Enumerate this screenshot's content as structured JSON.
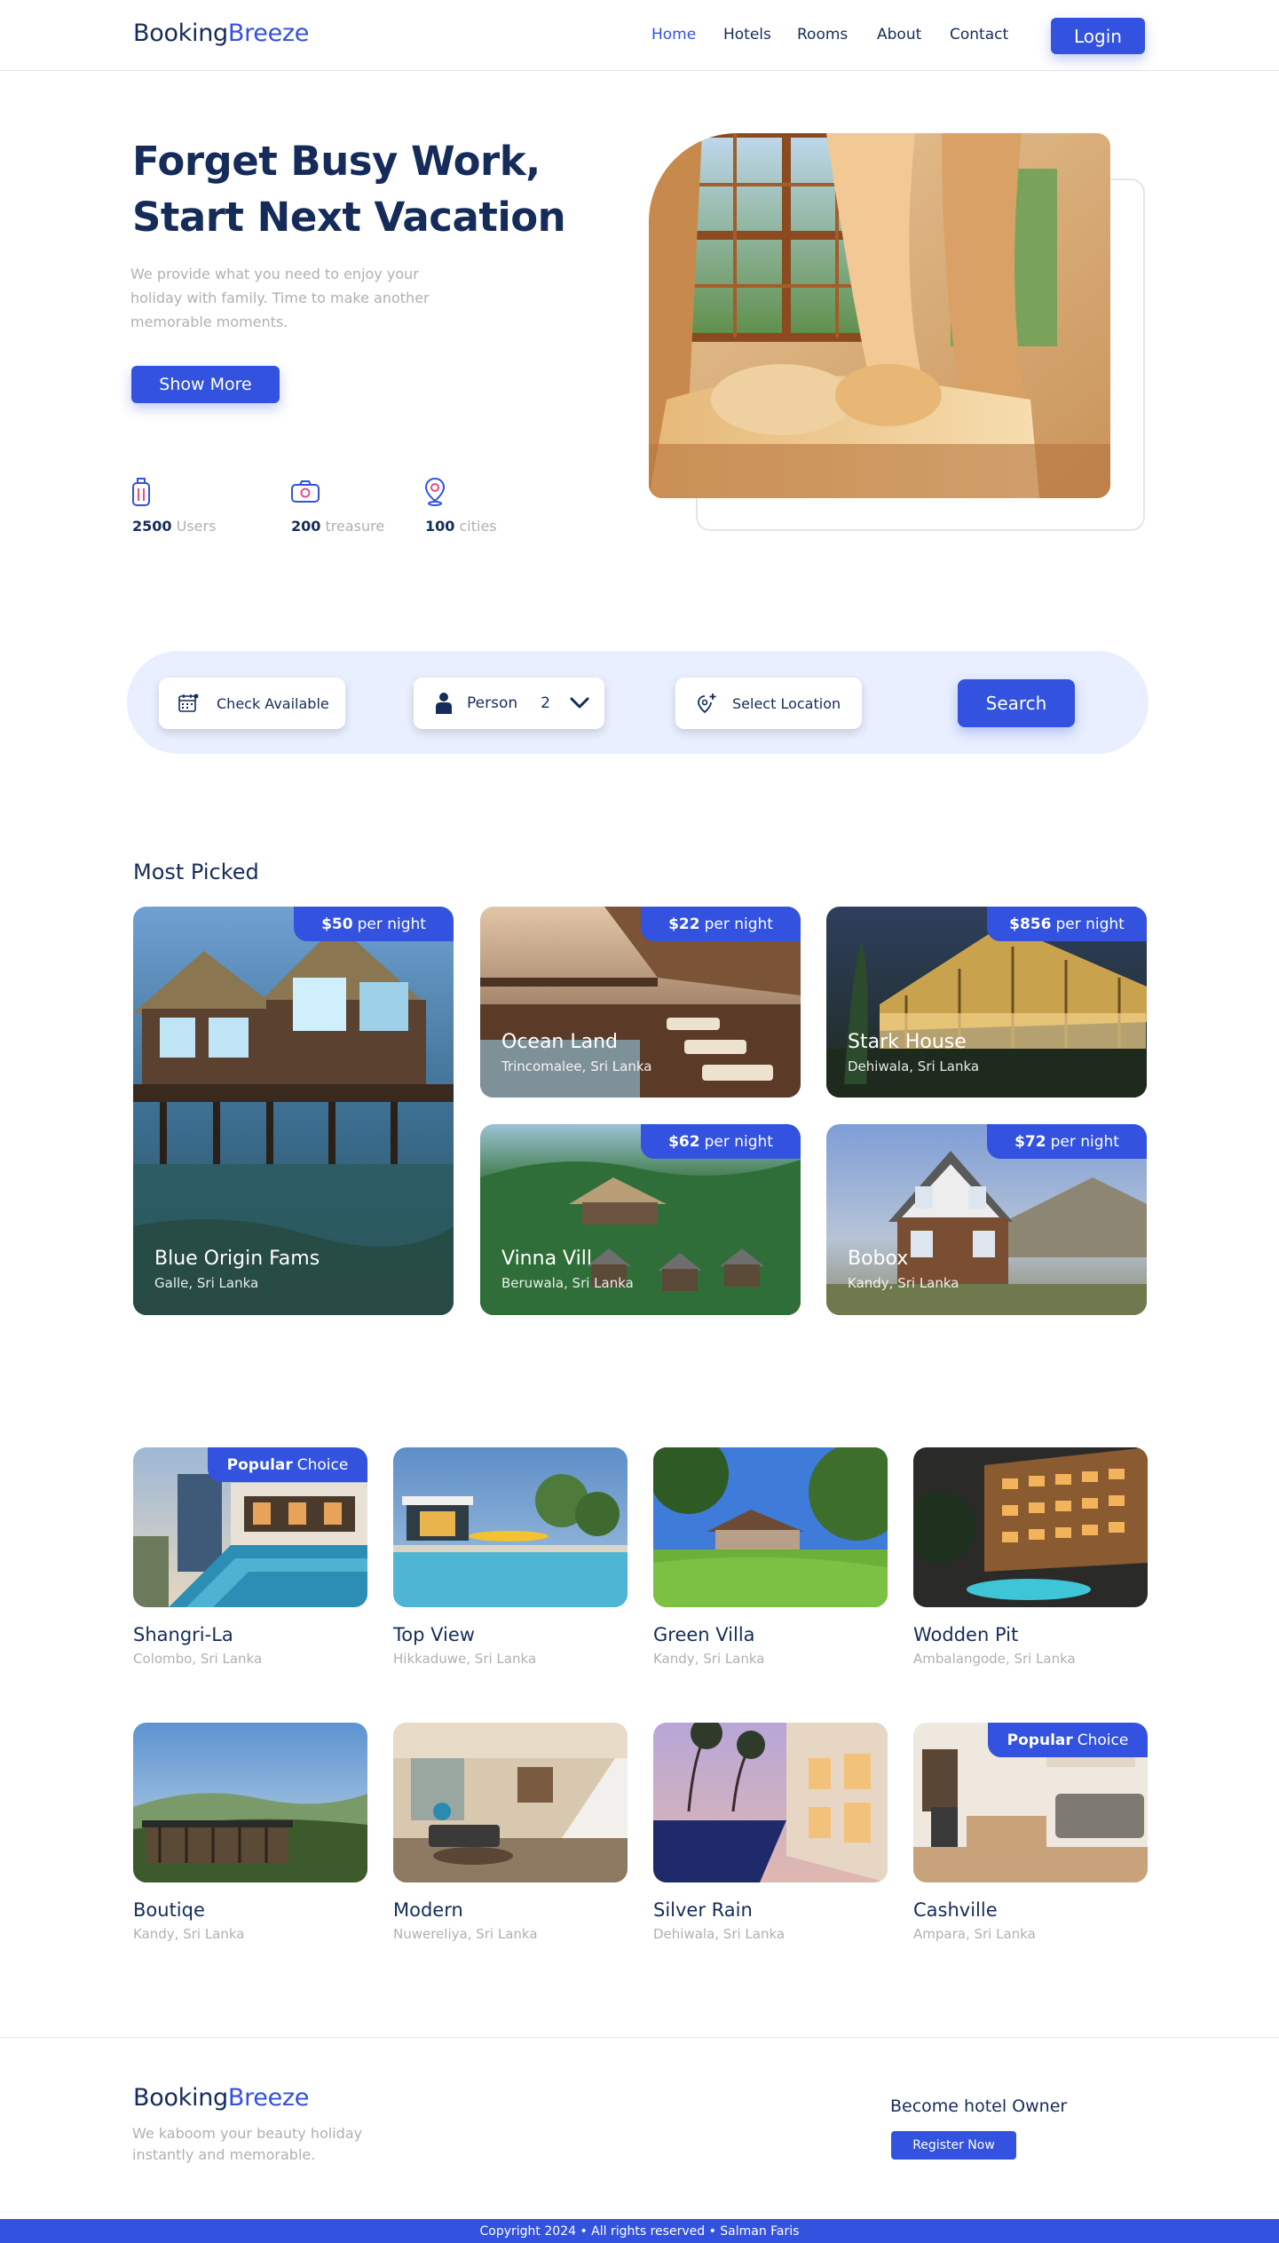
{
  "brand": {
    "part1": "Booking",
    "part2": "Breeze"
  },
  "nav": {
    "home": "Home",
    "hotels": "Hotels",
    "rooms": "Rooms",
    "about": "About",
    "contact": "Contact",
    "login": "Login"
  },
  "hero": {
    "title_line1": "Forget Busy Work,",
    "title_line2": "Start Next Vacation",
    "description": "We provide what you need to enjoy your holiday with family. Time to make another memorable moments.",
    "cta": "Show More",
    "stats": [
      {
        "value": "2500",
        "label": "Users",
        "icon": "suitcase-icon"
      },
      {
        "value": "200",
        "label": "treasure",
        "icon": "camera-icon"
      },
      {
        "value": "100",
        "label": "cities",
        "icon": "map-pin-icon"
      }
    ]
  },
  "search": {
    "check_label": "Check Available",
    "person_label": "Person",
    "person_count": "2",
    "location_label": "Select Location",
    "search_button": "Search"
  },
  "most_picked": {
    "title": "Most Picked",
    "per_night": "per night",
    "items": [
      {
        "price": "$50",
        "name": "Blue Origin Fams",
        "location": "Galle, Sri Lanka"
      },
      {
        "price": "$22",
        "name": "Ocean Land",
        "location": "Trincomalee, Sri Lanka"
      },
      {
        "price": "$856",
        "name": "Stark House",
        "location": "Dehiwala, Sri Lanka"
      },
      {
        "price": "$62",
        "name": "Vinna Vill",
        "location": "Beruwala, Sri Lanka"
      },
      {
        "price": "$72",
        "name": "Bobox",
        "location": "Kandy, Sri Lanka"
      }
    ]
  },
  "badge": {
    "popular": "Popular",
    "choice": "Choice"
  },
  "hotels": [
    {
      "name": "Shangri-La",
      "location": "Colombo, Sri Lanka"
    },
    {
      "name": "Top View",
      "location": "Hikkaduwe, Sri Lanka"
    },
    {
      "name": "Green Villa",
      "location": "Kandy, Sri Lanka"
    },
    {
      "name": "Wodden Pit",
      "location": "Ambalangode, Sri Lanka"
    },
    {
      "name": "Boutiqe",
      "location": "Kandy, Sri Lanka"
    },
    {
      "name": "Modern",
      "location": "Nuwereliya, Sri Lanka"
    },
    {
      "name": "Silver Rain",
      "location": "Dehiwala, Sri Lanka"
    },
    {
      "name": "Cashville",
      "location": "Ampara, Sri Lanka"
    }
  ],
  "footer": {
    "description": "We kaboom your beauty holiday instantly and memorable.",
    "owner_title": "Become hotel Owner",
    "register": "Register Now",
    "copyright": "Copyright 2024 • All rights reserved • Salman Faris"
  },
  "colors": {
    "primary": "#3252DF",
    "navy": "#152C5B",
    "muted": "#B0B0B0",
    "search_bg": "#E9EFFF"
  }
}
